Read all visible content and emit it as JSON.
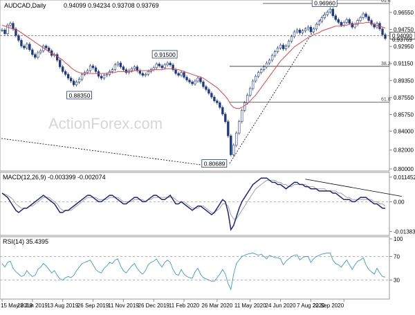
{
  "chart_data": [
    {
      "type": "candlestick",
      "header": {
        "title": "AUDCAD,Daily",
        "ohlc": "0.94099 0.94234 0.93708 0.93769"
      },
      "watermark": "ActionForex.com",
      "ylim": [
        0.8,
        0.975
      ],
      "y_ticks": [
        "0.96550",
        "0.94750",
        "0.92950",
        "0.91150",
        "0.89350",
        "0.87550",
        "0.85750",
        "0.84000",
        "0.82000",
        "0.80000"
      ],
      "y_tick_values": [
        0.9655,
        0.9475,
        0.9295,
        0.9115,
        0.8935,
        0.8755,
        0.8575,
        0.84,
        0.82,
        0.8
      ],
      "current_price_label": "0.94090",
      "current_price_label_value": 0.9409,
      "current_price_label2": "0.93769",
      "current_price_label2_value": 0.93769,
      "fib_levels": [
        {
          "label": "61.8",
          "value": 0.975
        },
        {
          "label": "38.2",
          "value": 0.9085
        },
        {
          "label": "61.8",
          "value": 0.8705
        }
      ],
      "price_annotations": [
        {
          "label": "0.96960",
          "value": 0.9696,
          "index": 122
        },
        {
          "label": "0.91500",
          "value": 0.915,
          "index": 59
        },
        {
          "label": "0.88350",
          "value": 0.8835,
          "index": 28
        },
        {
          "label": "0.80689",
          "value": 0.80689,
          "index": 83
        }
      ],
      "series": [
        {
          "name": "price",
          "color": "#1f3a80",
          "values": [
            0.947,
            0.943,
            0.952,
            0.954,
            0.948,
            0.941,
            0.936,
            0.93,
            0.928,
            0.932,
            0.926,
            0.921,
            0.918,
            0.923,
            0.925,
            0.93,
            0.928,
            0.925,
            0.92,
            0.921,
            0.915,
            0.908,
            0.903,
            0.9,
            0.896,
            0.893,
            0.889,
            0.892,
            0.895,
            0.9,
            0.902,
            0.904,
            0.909,
            0.907,
            0.903,
            0.898,
            0.896,
            0.899,
            0.9,
            0.903,
            0.905,
            0.91,
            0.912,
            0.908,
            0.905,
            0.902,
            0.904,
            0.906,
            0.908,
            0.904,
            0.901,
            0.899,
            0.9,
            0.903,
            0.905,
            0.907,
            0.911,
            0.909,
            0.907,
            0.91,
            0.912,
            0.91,
            0.905,
            0.901,
            0.899,
            0.902,
            0.897,
            0.894,
            0.892,
            0.89,
            0.893,
            0.896,
            0.892,
            0.887,
            0.884,
            0.88,
            0.876,
            0.872,
            0.87,
            0.865,
            0.858,
            0.85,
            0.835,
            0.815,
            0.825,
            0.838,
            0.85,
            0.862,
            0.87,
            0.878,
            0.885,
            0.893,
            0.898,
            0.902,
            0.905,
            0.908,
            0.912,
            0.915,
            0.92,
            0.924,
            0.928,
            0.931,
            0.927,
            0.93,
            0.935,
            0.94,
            0.945,
            0.947,
            0.944,
            0.946,
            0.948,
            0.95,
            0.945,
            0.948,
            0.953,
            0.956,
            0.96,
            0.963,
            0.966,
            0.969,
            0.962,
            0.958,
            0.955,
            0.952,
            0.955,
            0.958,
            0.954,
            0.95,
            0.953,
            0.957,
            0.96,
            0.964,
            0.961,
            0.957,
            0.953,
            0.95,
            0.954,
            0.948,
            0.942,
            0.938
          ]
        },
        {
          "name": "ma",
          "color": "#e84040",
          "values": [
            0.952,
            0.951,
            0.95,
            0.949,
            0.948,
            0.947,
            0.946,
            0.944,
            0.942,
            0.94,
            0.938,
            0.936,
            0.934,
            0.932,
            0.93,
            0.928,
            0.926,
            0.924,
            0.922,
            0.921,
            0.919,
            0.917,
            0.915,
            0.912,
            0.91,
            0.907,
            0.905,
            0.903,
            0.902,
            0.901,
            0.901,
            0.901,
            0.901,
            0.901,
            0.901,
            0.901,
            0.901,
            0.901,
            0.901,
            0.902,
            0.902,
            0.902,
            0.903,
            0.903,
            0.903,
            0.903,
            0.903,
            0.903,
            0.904,
            0.904,
            0.904,
            0.904,
            0.904,
            0.904,
            0.904,
            0.905,
            0.905,
            0.905,
            0.905,
            0.906,
            0.906,
            0.906,
            0.906,
            0.905,
            0.905,
            0.904,
            0.903,
            0.902,
            0.901,
            0.9,
            0.899,
            0.898,
            0.897,
            0.896,
            0.894,
            0.892,
            0.89,
            0.888,
            0.886,
            0.883,
            0.88,
            0.877,
            0.873,
            0.868,
            0.865,
            0.864,
            0.864,
            0.865,
            0.867,
            0.869,
            0.872,
            0.875,
            0.878,
            0.882,
            0.886,
            0.89,
            0.894,
            0.898,
            0.902,
            0.906,
            0.91,
            0.914,
            0.917,
            0.92,
            0.923,
            0.926,
            0.929,
            0.931,
            0.933,
            0.935,
            0.937,
            0.939,
            0.94,
            0.942,
            0.943,
            0.944,
            0.946,
            0.947,
            0.948,
            0.949,
            0.95,
            0.951,
            0.951,
            0.951,
            0.952,
            0.952,
            0.953,
            0.953,
            0.953,
            0.954,
            0.954,
            0.954,
            0.955,
            0.955,
            0.954,
            0.953,
            0.952,
            0.951,
            0.95,
            0.949
          ]
        }
      ]
    },
    {
      "type": "line",
      "title": "MACD(12,26,9) -0.003399 -0.002074",
      "ylim": [
        -0.015,
        0.013
      ],
      "y_ticks": [
        "0.011452",
        "0.00",
        "-0.013831"
      ],
      "y_tick_values": [
        0.011452,
        0.0,
        -0.013831
      ],
      "series": [
        {
          "name": "macd",
          "color": "#1a237e",
          "values": [
            0.004,
            0.003,
            0.002,
            0.0,
            -0.002,
            -0.004,
            -0.005,
            -0.004,
            -0.003,
            -0.003,
            -0.002,
            -0.001,
            0.0,
            0.001,
            0.002,
            0.003,
            0.002,
            0.001,
            0.0,
            -0.001,
            -0.003,
            -0.005,
            -0.005,
            -0.004,
            -0.004,
            -0.003,
            -0.002,
            -0.001,
            0.0,
            0.001,
            0.002,
            0.003,
            0.003,
            0.002,
            0.001,
            0.0,
            0.0,
            0.001,
            0.002,
            0.003,
            0.003,
            0.002,
            0.001,
            0.0,
            -0.001,
            -0.001,
            0.0,
            0.001,
            0.002,
            0.002,
            0.001,
            0.0,
            0.0,
            0.001,
            0.002,
            0.003,
            0.003,
            0.002,
            0.001,
            0.001,
            0.002,
            0.003,
            0.001,
            -0.001,
            -0.001,
            0.0,
            -0.001,
            -0.002,
            -0.003,
            -0.004,
            -0.003,
            -0.002,
            -0.002,
            -0.003,
            -0.004,
            -0.005,
            -0.006,
            -0.005,
            -0.003,
            -0.001,
            0.001,
            0.0,
            -0.005,
            -0.013,
            -0.011,
            -0.007,
            -0.003,
            0.0,
            0.002,
            0.004,
            0.006,
            0.008,
            0.009,
            0.01,
            0.011,
            0.011,
            0.011,
            0.01,
            0.009,
            0.009,
            0.008,
            0.008,
            0.007,
            0.006,
            0.007,
            0.008,
            0.009,
            0.009,
            0.008,
            0.008,
            0.007,
            0.007,
            0.006,
            0.006,
            0.006,
            0.005,
            0.005,
            0.005,
            0.005,
            0.005,
            0.004,
            0.004,
            0.003,
            0.002,
            0.001,
            0.001,
            0.001,
            0.0,
            0.0,
            0.001,
            0.002,
            0.002,
            0.002,
            0.001,
            0.0,
            -0.001,
            -0.001,
            -0.002,
            -0.003,
            -0.003
          ]
        },
        {
          "name": "signal",
          "color": "#a0a0a0",
          "values": [
            0.004,
            0.0035,
            0.003,
            0.002,
            0.001,
            -0.001,
            -0.002,
            -0.003,
            -0.003,
            -0.003,
            -0.002,
            -0.002,
            -0.001,
            0.0,
            0.001,
            0.002,
            0.002,
            0.002,
            0.001,
            0.0,
            -0.001,
            -0.003,
            -0.004,
            -0.004,
            -0.004,
            -0.004,
            -0.003,
            -0.002,
            -0.001,
            0.0,
            0.001,
            0.002,
            0.002,
            0.002,
            0.002,
            0.001,
            0.001,
            0.001,
            0.001,
            0.002,
            0.002,
            0.002,
            0.002,
            0.001,
            0.0,
            0.0,
            0.0,
            0.0,
            0.001,
            0.001,
            0.001,
            0.001,
            0.0,
            0.001,
            0.001,
            0.002,
            0.002,
            0.002,
            0.002,
            0.002,
            0.002,
            0.002,
            0.002,
            0.001,
            0.0,
            0.0,
            0.0,
            -0.001,
            -0.002,
            -0.003,
            -0.003,
            -0.003,
            -0.002,
            -0.002,
            -0.003,
            -0.004,
            -0.005,
            -0.005,
            -0.004,
            -0.003,
            -0.001,
            -0.001,
            -0.002,
            -0.006,
            -0.008,
            -0.008,
            -0.006,
            -0.004,
            -0.002,
            0.0,
            0.002,
            0.004,
            0.006,
            0.007,
            0.008,
            0.009,
            0.01,
            0.01,
            0.01,
            0.01,
            0.009,
            0.009,
            0.008,
            0.008,
            0.007,
            0.007,
            0.008,
            0.008,
            0.008,
            0.008,
            0.008,
            0.007,
            0.007,
            0.007,
            0.006,
            0.006,
            0.006,
            0.006,
            0.005,
            0.005,
            0.005,
            0.005,
            0.004,
            0.004,
            0.003,
            0.002,
            0.002,
            0.001,
            0.001,
            0.001,
            0.001,
            0.001,
            0.001,
            0.001,
            0.001,
            0.0,
            0.0,
            -0.001,
            -0.001,
            -0.002
          ]
        }
      ],
      "trendline": {
        "from": [
          110,
          0.0105
        ],
        "to": [
          145,
          0.0025
        ]
      }
    },
    {
      "type": "line",
      "title": "RSI(14) 35.4395",
      "ylim": [
        0,
        100
      ],
      "y_ticks": [
        "100",
        "70",
        "30",
        "0"
      ],
      "y_tick_values": [
        100,
        70,
        30,
        0
      ],
      "series": [
        {
          "name": "rsi",
          "color": "#3a9ad9",
          "values": [
            58,
            52,
            60,
            62,
            50,
            44,
            40,
            36,
            38,
            46,
            40,
            36,
            38,
            48,
            52,
            58,
            54,
            48,
            42,
            46,
            38,
            32,
            30,
            34,
            36,
            34,
            38,
            46,
            52,
            58,
            60,
            62,
            64,
            56,
            48,
            44,
            42,
            50,
            54,
            60,
            58,
            64,
            66,
            54,
            46,
            42,
            48,
            54,
            58,
            50,
            44,
            40,
            46,
            56,
            60,
            62,
            66,
            58,
            52,
            60,
            64,
            60,
            48,
            40,
            38,
            48,
            40,
            36,
            34,
            33,
            44,
            50,
            40,
            34,
            32,
            30,
            28,
            28,
            34,
            40,
            48,
            40,
            24,
            14,
            40,
            58,
            64,
            70,
            72,
            74,
            75,
            76,
            74,
            72,
            74,
            70,
            66,
            72,
            70,
            68,
            68,
            66,
            56,
            62,
            66,
            70,
            72,
            73,
            64,
            68,
            70,
            70,
            60,
            66,
            70,
            72,
            74,
            75,
            76,
            76,
            64,
            58,
            56,
            52,
            58,
            64,
            56,
            48,
            56,
            62,
            64,
            68,
            56,
            48,
            44,
            40,
            50,
            42,
            36,
            35
          ]
        }
      ]
    }
  ],
  "x_axis": {
    "labels": [
      "15 May 2019",
      "28 Jun 2019",
      "13 Aug 2019",
      "26 Sep 2019",
      "11 Nov 2019",
      "26 Dec 2019",
      "11 Feb 2020",
      "26 Mar 2020",
      "11 May 2020",
      "24 Jun 2020",
      "7 Aug 2020",
      "22 Sep 2020"
    ],
    "label_index": [
      0,
      11,
      22,
      33,
      44,
      55,
      66,
      78,
      90,
      101,
      112,
      124
    ]
  }
}
